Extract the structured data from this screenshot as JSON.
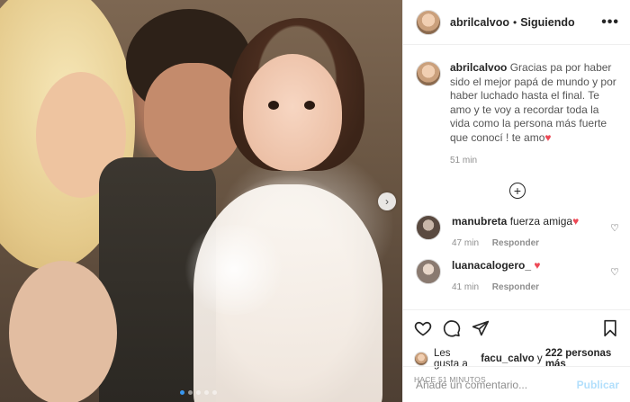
{
  "post": {
    "username": "abrilcalvoo",
    "separator": "•",
    "follow_state": "Siguiendo",
    "more_icon": "•••",
    "caption": "Gracias pa por haber sido el mejor papá de mundo y por haber luchado hasta el final. Te amo y te voy a recordar toda la vida como la persona más fuerte que conocí ! te amo",
    "caption_emoji": "♥",
    "caption_time": "51 min",
    "load_more_icon": "+",
    "next_icon": "›"
  },
  "comments": [
    {
      "username": "manubreta",
      "text": "fuerza amiga",
      "emoji": "♥",
      "time": "47 min",
      "reply_label": "Responder",
      "like_icon": "♡"
    },
    {
      "username": "luanacalogero_",
      "text": "",
      "emoji": "♥",
      "time": "41 min",
      "reply_label": "Responder",
      "like_icon": "♡"
    }
  ],
  "likes": {
    "prefix": "Les gusta a",
    "user": "facu_calvo",
    "connector": "y",
    "others": "222 personas más"
  },
  "timestamp": "HACE 51 MINUTOS",
  "composer": {
    "placeholder": "Añade un comentario...",
    "publish_label": "Publicar"
  },
  "carousel": {
    "slide_count": 5,
    "active_index": 0
  },
  "colors": {
    "accent": "#3897f0",
    "heart": "#ed4956",
    "publish_disabled": "#b2dffc"
  },
  "icons": [
    "heart-icon",
    "comment-icon",
    "share-icon",
    "bookmark-icon",
    "plus-circle-icon",
    "chevron-right-icon",
    "more-icon"
  ]
}
